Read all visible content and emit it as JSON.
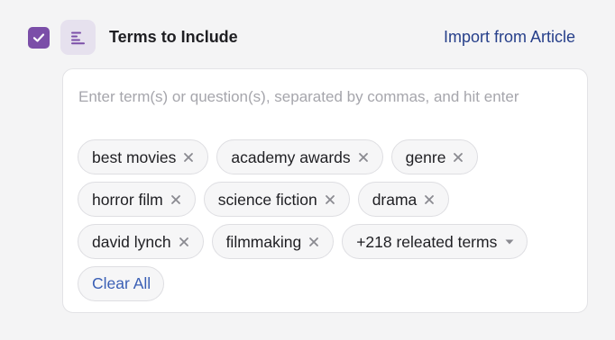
{
  "header": {
    "checkbox_checked": true,
    "title": "Terms to Include",
    "import_link": "Import from Article",
    "section_icon": "align-left-icon"
  },
  "input": {
    "value": "",
    "placeholder": "Enter term(s) or question(s), separated by commas, and hit enter"
  },
  "terms": [
    {
      "label": "best movies"
    },
    {
      "label": "academy awards"
    },
    {
      "label": "genre"
    },
    {
      "label": "horror film"
    },
    {
      "label": "science fiction"
    },
    {
      "label": "drama"
    },
    {
      "label": "david lynch"
    },
    {
      "label": "filmmaking"
    }
  ],
  "more_terms_label": "+218 releated terms",
  "clear_all_label": "Clear All",
  "colors": {
    "accent_purple": "#7b4ea8",
    "link_blue": "#263f8a",
    "clear_blue": "#3a5fb5"
  }
}
